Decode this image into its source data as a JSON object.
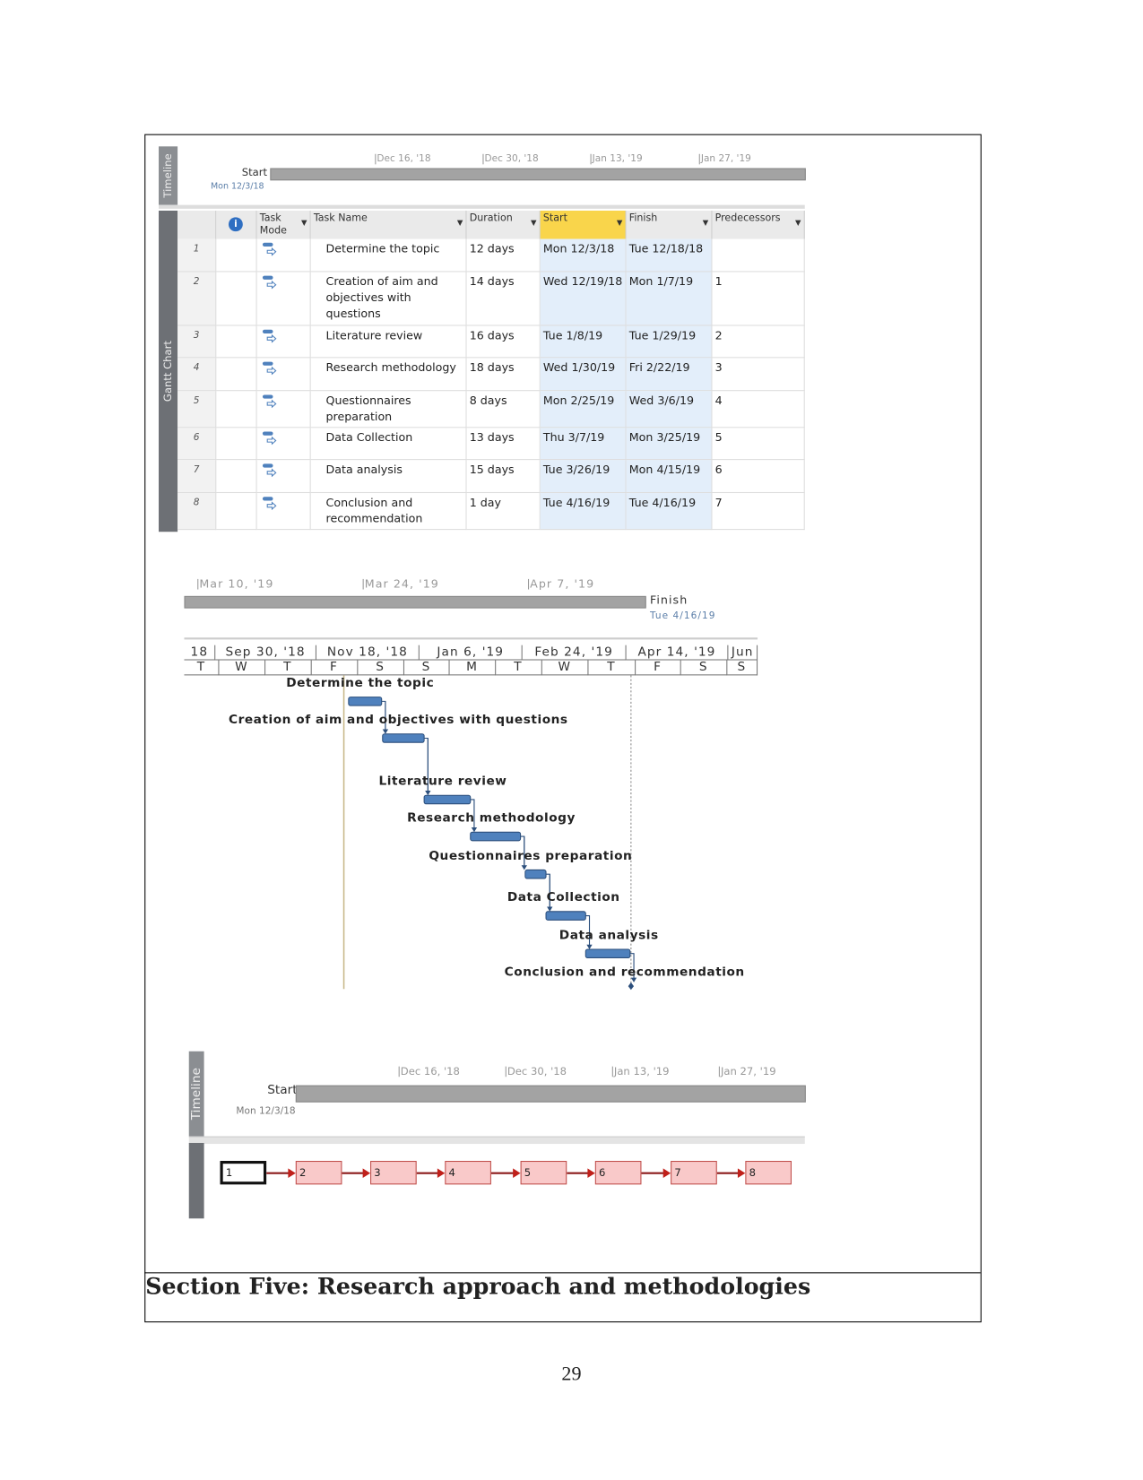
{
  "top_view": {
    "timeline_label": "Timeline",
    "gantt_label": "Gantt Chart",
    "start_label": "Start",
    "start_date": "Mon 12/3/18",
    "ticks": [
      "Dec 16, '18",
      "Dec 30, '18",
      "Jan 13, '19",
      "Jan 27, '19"
    ],
    "columns": [
      "Task Mode",
      "Task Name",
      "Duration",
      "Start",
      "Finish",
      "Predecessors"
    ],
    "highlight_color": "#f9d54b",
    "rows": [
      {
        "id": "1",
        "name": "Determine the topic",
        "duration": "12 days",
        "start": "Mon 12/3/18",
        "finish": "Tue 12/18/18",
        "pred": ""
      },
      {
        "id": "2",
        "name": "Creation of aim and objectives with questions",
        "duration": "14 days",
        "start": "Wed 12/19/18",
        "finish": "Mon 1/7/19",
        "pred": "1"
      },
      {
        "id": "3",
        "name": "Literature review",
        "duration": "16 days",
        "start": "Tue 1/8/19",
        "finish": "Tue 1/29/19",
        "pred": "2"
      },
      {
        "id": "4",
        "name": "Research methodology",
        "duration": "18 days",
        "start": "Wed 1/30/19",
        "finish": "Fri 2/22/19",
        "pred": "3"
      },
      {
        "id": "5",
        "name": "Questionnaires preparation",
        "duration": "8 days",
        "start": "Mon 2/25/19",
        "finish": "Wed 3/6/19",
        "pred": "4"
      },
      {
        "id": "6",
        "name": "Data Collection",
        "duration": "13 days",
        "start": "Thu 3/7/19",
        "finish": "Mon 3/25/19",
        "pred": "5"
      },
      {
        "id": "7",
        "name": "Data analysis",
        "duration": "15 days",
        "start": "Tue 3/26/19",
        "finish": "Mon 4/15/19",
        "pred": "6"
      },
      {
        "id": "8",
        "name": "Conclusion and recommendation",
        "duration": "1 day",
        "start": "Tue 4/16/19",
        "finish": "Tue 4/16/19",
        "pred": "7"
      }
    ]
  },
  "gantt_view": {
    "ticks": [
      "Mar 10, '19",
      "Mar 24, '19",
      "Apr 7, '19"
    ],
    "finish_label": "Finish",
    "finish_date": "Tue 4/16/19",
    "major": [
      "18",
      "Sep 30, '18",
      "Nov 18, '18",
      "Jan 6, '19",
      "Feb 24, '19",
      "Apr 14, '19",
      "Jun"
    ],
    "minor": [
      "T",
      "W",
      "T",
      "F",
      "S",
      "S",
      "M",
      "T",
      "W",
      "T",
      "F",
      "S",
      "S"
    ],
    "bar_color": "#4f81bd",
    "task_labels": [
      "Determine the topic",
      "Creation of aim and objectives with questions",
      "Literature review",
      "Research methodology",
      "Questionnaires preparation",
      "Data Collection",
      "Data analysis",
      "Conclusion and recommendation"
    ]
  },
  "network_view": {
    "timeline_label": "Timeline",
    "start_label": "Start",
    "start_date": "Mon 12/3/18",
    "ticks": [
      "Dec 16, '18",
      "Dec 30, '18",
      "Jan 13, '19",
      "Jan 27, '19"
    ],
    "nodes": [
      "1",
      "2",
      "3",
      "4",
      "5",
      "6",
      "7",
      "8"
    ],
    "node_color": "#f9c9c9"
  },
  "section_heading": "Section Five: Research approach and methodologies",
  "page_number": "29"
}
